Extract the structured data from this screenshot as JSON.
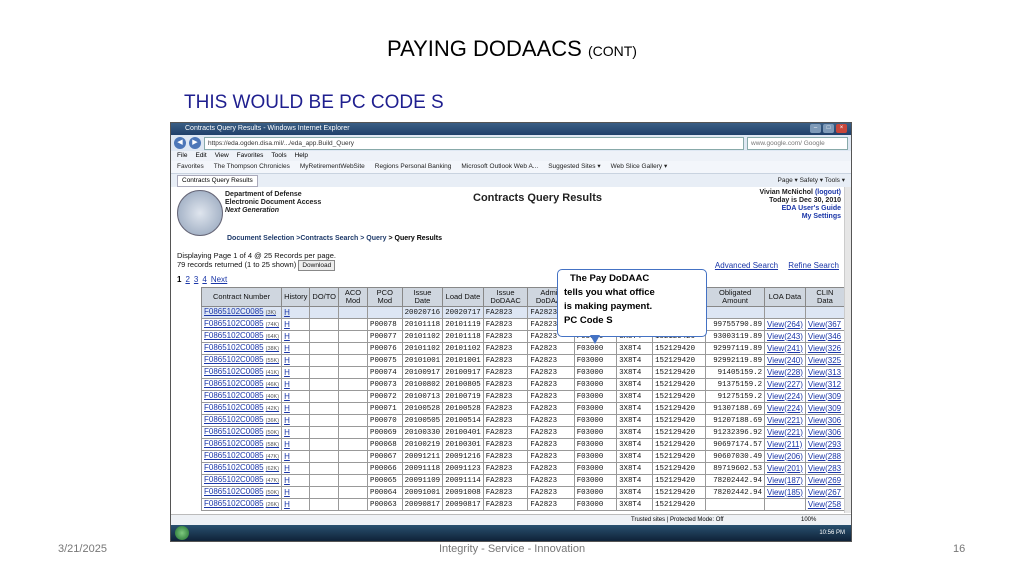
{
  "slide": {
    "title": "PAYING DODAACS",
    "title_suffix": "(CONT)",
    "subtitle": "THIS WOULD BE PC CODE S",
    "footer_date": "3/21/2025",
    "footer_center": "Integrity - Service - Innovation",
    "footer_page": "16"
  },
  "browser": {
    "window_title": "Contracts Query Results - Windows Internet Explorer",
    "address": "https://eda.ogden.disa.mil/.../eda_app.Build_Query",
    "search_placeholder": "www.google.com/ Google",
    "menu": [
      "File",
      "Edit",
      "View",
      "Favorites",
      "Tools",
      "Help"
    ],
    "favorites": [
      "Favorites",
      "The Thompson Chronicles",
      "MyRetirementWebSite",
      "Regions Personal Banking",
      "Microsoft Outlook Web A...",
      "Suggested Sites ▾",
      "Web Slice Gallery ▾"
    ],
    "tab_label": "Contracts Query Results",
    "command_bar": "Page ▾  Safety ▾  Tools ▾",
    "status_zone": "Trusted sites | Protected Mode: Off",
    "zoom": "100%",
    "clock": "10:56 PM"
  },
  "page": {
    "org_line1": "Department of Defense",
    "org_line2": "Electronic Document Access",
    "org_line3": "Next Generation",
    "heading": "Contracts Query Results",
    "user_name": "Vivian McNichol",
    "logout": "(logout)",
    "today": "Today is Dec 30, 2010",
    "users_guide": "EDA User's Guide",
    "settings": "My Settings",
    "crumb_1": "Document Selection",
    "crumb_2": ">Contracts Search",
    "crumb_3": "> Query",
    "crumb_4": "> Query Results",
    "display_line": "Displaying Page 1 of 4 @ 25 Records per page.",
    "records_line": "79 records returned (1 to 25 shown)",
    "download": "Download",
    "pages": [
      "1",
      "2",
      "3",
      "4",
      "Next"
    ],
    "advanced_search": "Advanced Search",
    "refine_search": "Refine Search"
  },
  "callout": {
    "line1": "The Pay DoDAAC",
    "line2": "tells you what office",
    "line3": "is making payment.",
    "line4": "PC Code S"
  },
  "table": {
    "headers": [
      "Contract Number",
      "History",
      "DO/TO",
      "ACO Mod",
      "PCO Mod",
      "Issue Date",
      "Load Date",
      "Issue DoDAAC",
      "Admin DoDAAC",
      "Pay DoDAAC",
      "CAGE Code",
      "D-U-N-S Number",
      "Obligated Amount",
      "LOA Data",
      "CLIN Data"
    ],
    "rows": [
      {
        "contract": "F0865102C0085",
        "size": "(3K)",
        "hist": "H",
        "pco": "",
        "issue": "20020716",
        "load": "20020717",
        "iss_d": "FA2823",
        "adm_d": "FA2823",
        "pay_d": "F03000",
        "cage": "1JGQ2",
        "duns": "127136252",
        "amount": "",
        "loa": "",
        "clin": ""
      },
      {
        "contract": "F0865102C0085",
        "size": "(74K)",
        "hist": "H",
        "pco": "P00078",
        "issue": "20101118",
        "load": "20101119",
        "iss_d": "FA2823",
        "adm_d": "FA2823",
        "pay_d": "F03000",
        "cage": "3X8T4",
        "duns": "152129420",
        "amount": "99755790.89",
        "loa": "View(264)",
        "clin": "View(367"
      },
      {
        "contract": "F0865102C0085",
        "size": "(64K)",
        "hist": "H",
        "pco": "P00077",
        "issue": "20101102",
        "load": "20101118",
        "iss_d": "FA2823",
        "adm_d": "FA2823",
        "pay_d": "F03000",
        "cage": "3X8T4",
        "duns": "152129420",
        "amount": "93003119.89",
        "loa": "View(243)",
        "clin": "View(346"
      },
      {
        "contract": "F0865102C0085",
        "size": "(38K)",
        "hist": "H",
        "pco": "P00076",
        "issue": "20101102",
        "load": "20101102",
        "iss_d": "FA2823",
        "adm_d": "FA2823",
        "pay_d": "F03000",
        "cage": "3X8T4",
        "duns": "152129420",
        "amount": "92997119.89",
        "loa": "View(241)",
        "clin": "View(326"
      },
      {
        "contract": "F0865102C0085",
        "size": "(55K)",
        "hist": "H",
        "pco": "P00075",
        "issue": "20101001",
        "load": "20101001",
        "iss_d": "FA2823",
        "adm_d": "FA2823",
        "pay_d": "F03000",
        "cage": "3X8T4",
        "duns": "152129420",
        "amount": "92992119.89",
        "loa": "View(240)",
        "clin": "View(325"
      },
      {
        "contract": "F0865102C0085",
        "size": "(41K)",
        "hist": "H",
        "pco": "P00074",
        "issue": "20100917",
        "load": "20100917",
        "iss_d": "FA2823",
        "adm_d": "FA2823",
        "pay_d": "F03000",
        "cage": "3X8T4",
        "duns": "152129420",
        "amount": "91405159.2",
        "loa": "View(228)",
        "clin": "View(313"
      },
      {
        "contract": "F0865102C0085",
        "size": "(46K)",
        "hist": "H",
        "pco": "P00073",
        "issue": "20100802",
        "load": "20100805",
        "iss_d": "FA2823",
        "adm_d": "FA2823",
        "pay_d": "F03000",
        "cage": "3X8T4",
        "duns": "152129420",
        "amount": "91375159.2",
        "loa": "View(227)",
        "clin": "View(312"
      },
      {
        "contract": "F0865102C0085",
        "size": "(40K)",
        "hist": "H",
        "pco": "P00072",
        "issue": "20100713",
        "load": "20100719",
        "iss_d": "FA2823",
        "adm_d": "FA2823",
        "pay_d": "F03000",
        "cage": "3X8T4",
        "duns": "152129420",
        "amount": "91275159.2",
        "loa": "View(224)",
        "clin": "View(309"
      },
      {
        "contract": "F0865102C0085",
        "size": "(42K)",
        "hist": "H",
        "pco": "P00071",
        "issue": "20100528",
        "load": "20100528",
        "iss_d": "FA2823",
        "adm_d": "FA2823",
        "pay_d": "F03000",
        "cage": "3X8T4",
        "duns": "152129420",
        "amount": "91307188.69",
        "loa": "View(224)",
        "clin": "View(309"
      },
      {
        "contract": "F0865102C0085",
        "size": "(36K)",
        "hist": "H",
        "pco": "P00070",
        "issue": "20100505",
        "load": "20100514",
        "iss_d": "FA2823",
        "adm_d": "FA2823",
        "pay_d": "F03000",
        "cage": "3X8T4",
        "duns": "152129420",
        "amount": "91207188.69",
        "loa": "View(221)",
        "clin": "View(306"
      },
      {
        "contract": "F0865102C0085",
        "size": "(50K)",
        "hist": "H",
        "pco": "P00069",
        "issue": "20100330",
        "load": "20100401",
        "iss_d": "FA2823",
        "adm_d": "FA2823",
        "pay_d": "F03000",
        "cage": "3X8T4",
        "duns": "152129420",
        "amount": "91232396.92",
        "loa": "View(221)",
        "clin": "View(306"
      },
      {
        "contract": "F0865102C0085",
        "size": "(58K)",
        "hist": "H",
        "pco": "P00068",
        "issue": "20100219",
        "load": "20100301",
        "iss_d": "FA2823",
        "adm_d": "FA2823",
        "pay_d": "F03000",
        "cage": "3X8T4",
        "duns": "152129420",
        "amount": "90697174.57",
        "loa": "View(211)",
        "clin": "View(293"
      },
      {
        "contract": "F0865102C0085",
        "size": "(47K)",
        "hist": "H",
        "pco": "P00067",
        "issue": "20091211",
        "load": "20091216",
        "iss_d": "FA2823",
        "adm_d": "FA2823",
        "pay_d": "F03000",
        "cage": "3X8T4",
        "duns": "152129420",
        "amount": "90607030.49",
        "loa": "View(206)",
        "clin": "View(288"
      },
      {
        "contract": "F0865102C0085",
        "size": "(62K)",
        "hist": "H",
        "pco": "P00066",
        "issue": "20091118",
        "load": "20091123",
        "iss_d": "FA2823",
        "adm_d": "FA2823",
        "pay_d": "F03000",
        "cage": "3X8T4",
        "duns": "152129420",
        "amount": "89719602.53",
        "loa": "View(201)",
        "clin": "View(283"
      },
      {
        "contract": "F0865102C0085",
        "size": "(47K)",
        "hist": "H",
        "pco": "P00065",
        "issue": "20091109",
        "load": "20091114",
        "iss_d": "FA2823",
        "adm_d": "FA2823",
        "pay_d": "F03000",
        "cage": "3X8T4",
        "duns": "152129420",
        "amount": "78202442.94",
        "loa": "View(187)",
        "clin": "View(269"
      },
      {
        "contract": "F0865102C0085",
        "size": "(50K)",
        "hist": "H",
        "pco": "P00064",
        "issue": "20091001",
        "load": "20091008",
        "iss_d": "FA2823",
        "adm_d": "FA2823",
        "pay_d": "F03000",
        "cage": "3X8T4",
        "duns": "152129420",
        "amount": "78202442.94",
        "loa": "View(185)",
        "clin": "View(267"
      },
      {
        "contract": "F0865102C0085",
        "size": "(26K)",
        "hist": "H",
        "pco": "P00063",
        "issue": "20090817",
        "load": "20090817",
        "iss_d": "FA2823",
        "adm_d": "FA2823",
        "pay_d": "F03000",
        "cage": "3X8T4",
        "duns": "152129420",
        "amount": "",
        "loa": "",
        "clin": "View(258"
      }
    ]
  }
}
